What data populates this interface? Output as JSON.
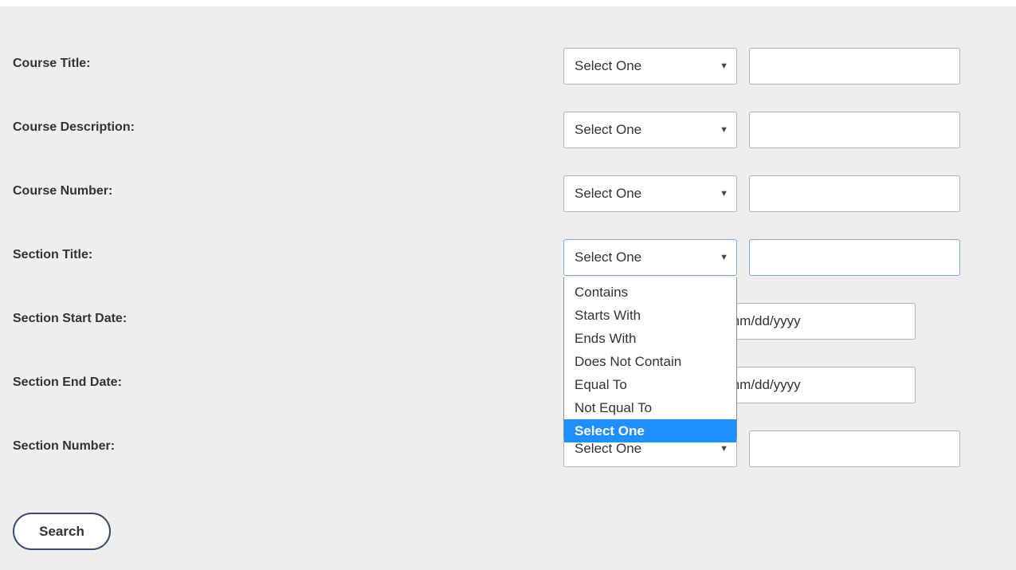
{
  "form": {
    "select_placeholder": "Select One",
    "date_placeholder": "mm/dd/yyyy",
    "fields": [
      {
        "label": "Course Title:",
        "type": "text"
      },
      {
        "label": "Course Description:",
        "type": "text"
      },
      {
        "label": "Course Number:",
        "type": "text"
      },
      {
        "label": "Section Title:",
        "type": "text"
      },
      {
        "label": "Section Start Date:",
        "type": "date"
      },
      {
        "label": "Section End Date:",
        "type": "date"
      },
      {
        "label": "Section Number:",
        "type": "text"
      }
    ],
    "dropdown": {
      "open_for_field": "Section Title:",
      "options": [
        "Contains",
        "Starts With",
        "Ends With",
        "Does Not Contain",
        "Equal To",
        "Not Equal To",
        "Select One"
      ],
      "highlighted_option": "Select One"
    },
    "search_label": "Search"
  },
  "colors": {
    "panel_bg": "#eeeeee",
    "highlight": "#1e90ff",
    "focus_border": "#7aa7e0",
    "button_border": "#3a4b6b"
  },
  "icons": {
    "select_arrow": "triangle-down-icon"
  }
}
